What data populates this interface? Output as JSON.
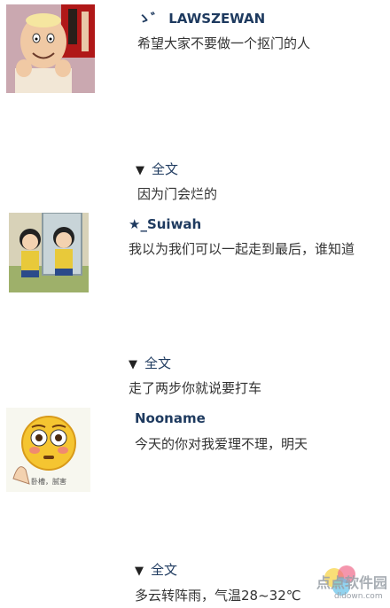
{
  "posts": [
    {
      "username": "ゝ゛ LAWSZEWAN",
      "message": "希望大家不要做一个抠门的人",
      "expand_label": "全文",
      "reply": "因为门会烂的"
    },
    {
      "username": "★_Suiwah",
      "message": "我以为我们可以一起走到最后，谁知道",
      "expand_label": "全文",
      "reply": "走了两步你就说要打车"
    },
    {
      "username": "Nooname",
      "message": "今天的你对我爱理不理，明天",
      "expand_label": "全文",
      "reply": "多云转阵雨，气温28~32℃",
      "avatar_caption": "卧槽，腻害"
    }
  ],
  "watermark": {
    "title": "点点软件园",
    "url": "dldown.com"
  }
}
